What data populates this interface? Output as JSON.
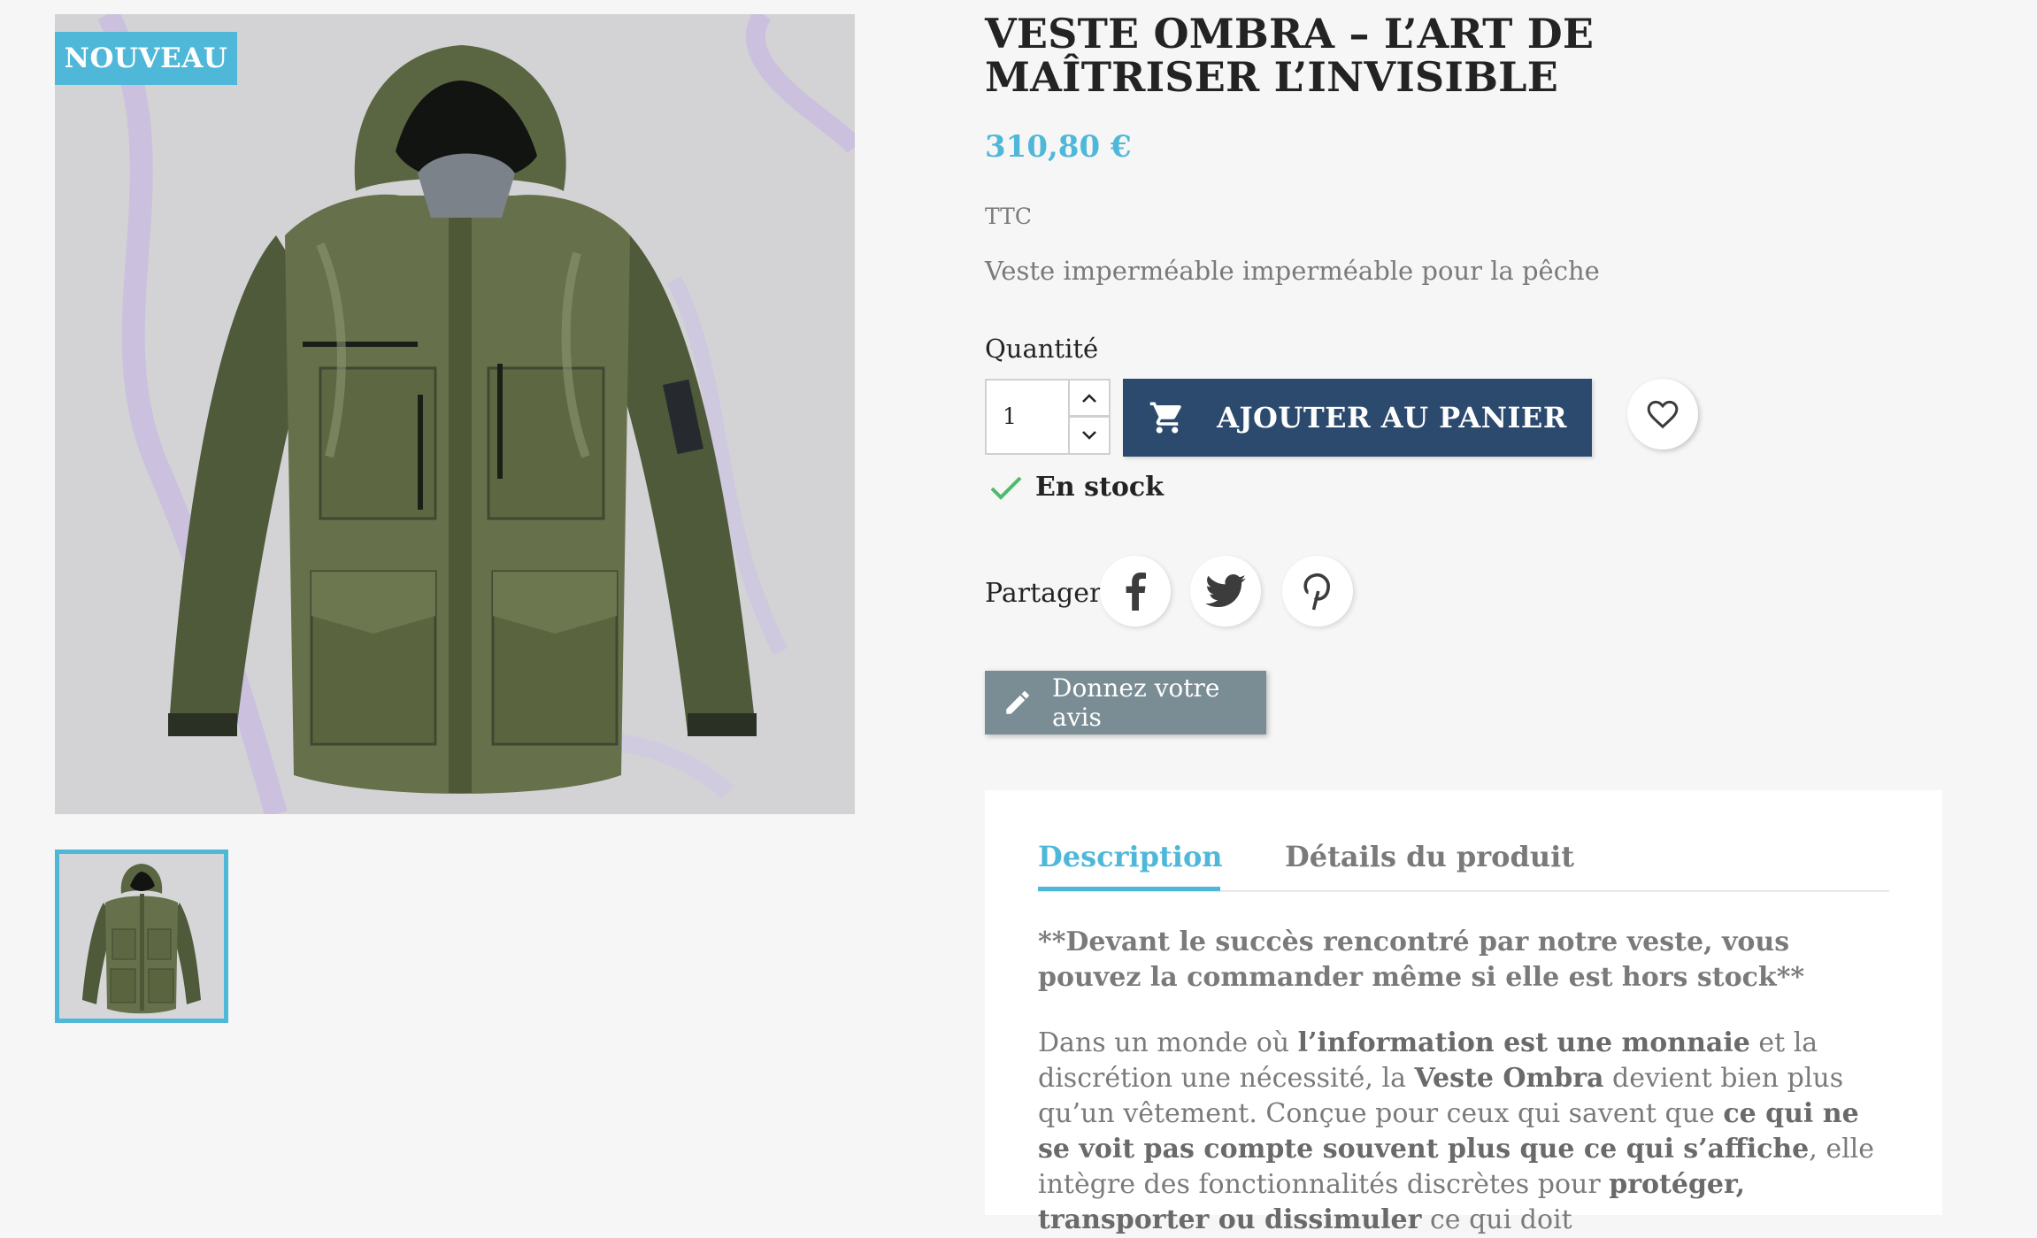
{
  "badge": {
    "label": "NOUVEAU"
  },
  "product": {
    "title": "VESTE OMBRA – L’ART DE MAÎTRISER L’INVISIBLE",
    "price": "310,80 €",
    "tax_label": "TTC",
    "short_description": "Veste imperméable imperméable pour la pêche"
  },
  "quantity": {
    "label": "Quantité",
    "value": "1"
  },
  "cart": {
    "button_label": "AJOUTER AU PANIER"
  },
  "stock": {
    "label": "En stock"
  },
  "share": {
    "label": "Partager",
    "networks": [
      "facebook",
      "twitter",
      "pinterest"
    ]
  },
  "review": {
    "button_label": "Donnez votre avis"
  },
  "tabs": [
    {
      "label": "Description",
      "active": true
    },
    {
      "label": "Détails du produit",
      "active": false
    }
  ],
  "description": {
    "lead": "**Devant le succès rencontré par notre veste, vous pouvez la commander même si elle est hors stock**",
    "p1_a": "Dans un monde où ",
    "p1_b": "l’information est une monnaie",
    "p1_c": " et la discrétion une nécessité, la ",
    "p1_d": "Veste Ombra",
    "p1_e": " devient bien plus qu’un vêtement. Conçue pour ceux qui savent que ",
    "p1_f": "ce qui ne se voit pas compte souvent plus que ce qui s’affiche",
    "p1_g": ", elle intègre des fonctionnalités discrètes pour ",
    "p1_h": "protéger, transporter ou dissimuler",
    "p1_i": " ce qui doit"
  },
  "colors": {
    "accent": "#4fb8d9",
    "cart_button": "#2c4a6e",
    "review_button": "#7a8d94",
    "stock_check": "#4cbb6c",
    "background": "#f6f6f6"
  },
  "icons": {
    "cart": "shopping-cart-icon",
    "wishlist": "heart-icon",
    "stock": "check-icon",
    "review": "pencil-icon",
    "qty_up": "chevron-up-icon",
    "qty_down": "chevron-down-icon"
  }
}
